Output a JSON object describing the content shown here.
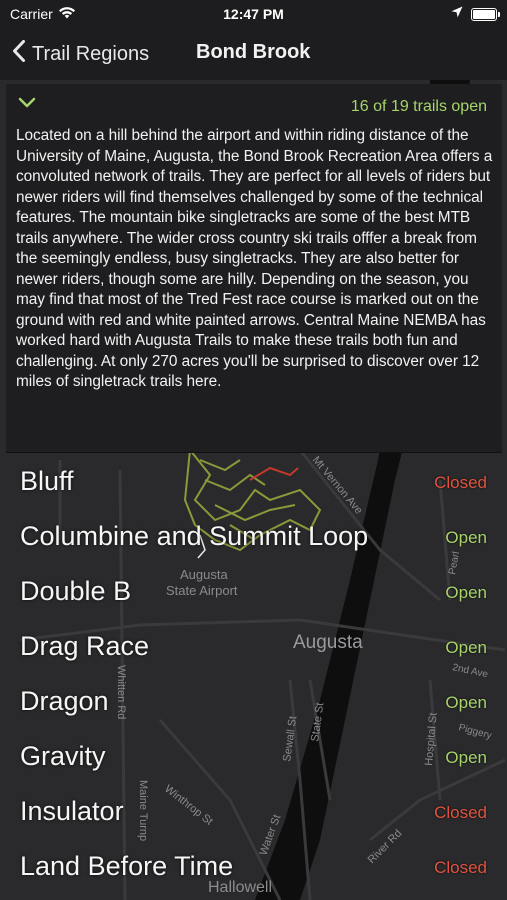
{
  "status_bar": {
    "carrier": "Carrier",
    "time": "12:47 PM",
    "icons": [
      "wifi-icon",
      "location-arrow-icon",
      "battery-icon"
    ]
  },
  "nav": {
    "back_label": "Trail Regions",
    "title": "Bond Brook"
  },
  "region": {
    "open_count": "16 of 19 trails open",
    "description": "Located on a hill behind the airport and within riding distance of the University of Maine, Augusta, the Bond Brook Recreation Area offers a convoluted network of trails. They are perfect for all levels of riders but newer riders will find themselves challenged by some of the technical features.  The mountain bike singletracks are some of the best MTB trails anywhere. The wider cross country ski trails offfer a break from the seemingly endless, busy singletracks. They are also better for newer riders, though some are hilly.  Depending on the season, you may find that most of the Tred Fest race course is marked out on the ground with red and white painted arrows.  Central Maine NEMBA has worked hard with Augusta Trails to make these trails both fun and challenging.  At only 270 acres you'll be surprised to discover over 12 miles of singletrack trails here."
  },
  "map_labels": {
    "augusta_state_airport": "Augusta\nState Airport",
    "augusta": "Augusta",
    "mt_vernon_ave": "Mt Vernon Ave",
    "hallowell": "Hallowell",
    "whitten_rd": "Whitten Rd",
    "sewall_st": "Sewall St",
    "state_st": "State St",
    "hospital_st": "Hospital St",
    "river_rd": "River Rd",
    "water_st": "Water St",
    "winthrop_st": "Winthrop St",
    "maine_turnpike": "Maine Turnp",
    "second_ave": "2nd Ave",
    "piggery": "Piggery",
    "pearl": "Pearl"
  },
  "colors": {
    "open": "#a6d46a",
    "closed": "#e0533f",
    "trail_overlay": "#8a9a3a"
  },
  "trails": [
    {
      "name": "Bluff",
      "status": "Closed"
    },
    {
      "name": "Columbine and Summit Loop",
      "status": "Open"
    },
    {
      "name": "Double B",
      "status": "Open"
    },
    {
      "name": "Drag Race",
      "status": "Open"
    },
    {
      "name": "Dragon",
      "status": "Open"
    },
    {
      "name": "Gravity",
      "status": "Open"
    },
    {
      "name": "Insulator",
      "status": "Closed"
    },
    {
      "name": "Land Before Time",
      "status": "Closed"
    }
  ]
}
